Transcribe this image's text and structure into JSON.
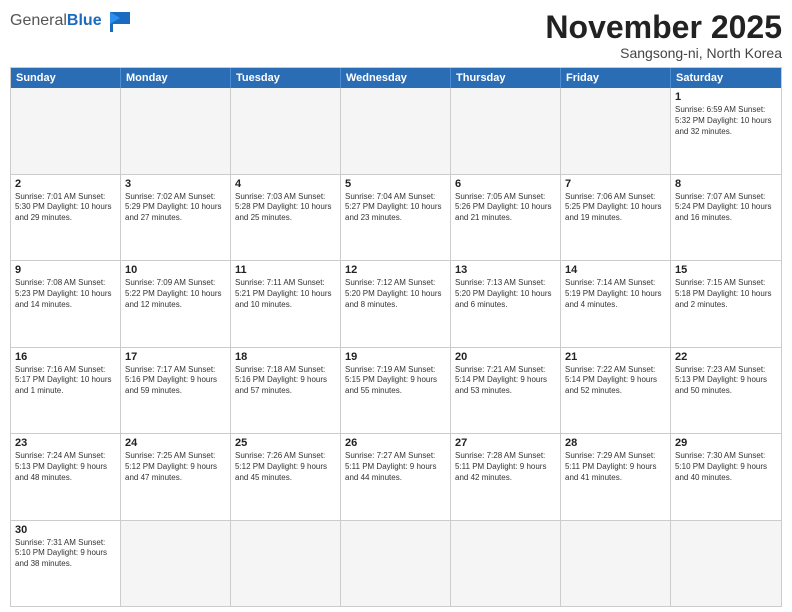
{
  "header": {
    "logo_general": "General",
    "logo_blue": "Blue",
    "month_title": "November 2025",
    "location": "Sangsong-ni, North Korea"
  },
  "days_of_week": [
    "Sunday",
    "Monday",
    "Tuesday",
    "Wednesday",
    "Thursday",
    "Friday",
    "Saturday"
  ],
  "weeks": [
    [
      {
        "day": "",
        "info": "",
        "empty": true
      },
      {
        "day": "",
        "info": "",
        "empty": true
      },
      {
        "day": "",
        "info": "",
        "empty": true
      },
      {
        "day": "",
        "info": "",
        "empty": true
      },
      {
        "day": "",
        "info": "",
        "empty": true
      },
      {
        "day": "",
        "info": "",
        "empty": true
      },
      {
        "day": "1",
        "info": "Sunrise: 6:59 AM\nSunset: 5:32 PM\nDaylight: 10 hours and 32 minutes.",
        "empty": false
      }
    ],
    [
      {
        "day": "2",
        "info": "Sunrise: 7:01 AM\nSunset: 5:30 PM\nDaylight: 10 hours and 29 minutes.",
        "empty": false
      },
      {
        "day": "3",
        "info": "Sunrise: 7:02 AM\nSunset: 5:29 PM\nDaylight: 10 hours and 27 minutes.",
        "empty": false
      },
      {
        "day": "4",
        "info": "Sunrise: 7:03 AM\nSunset: 5:28 PM\nDaylight: 10 hours and 25 minutes.",
        "empty": false
      },
      {
        "day": "5",
        "info": "Sunrise: 7:04 AM\nSunset: 5:27 PM\nDaylight: 10 hours and 23 minutes.",
        "empty": false
      },
      {
        "day": "6",
        "info": "Sunrise: 7:05 AM\nSunset: 5:26 PM\nDaylight: 10 hours and 21 minutes.",
        "empty": false
      },
      {
        "day": "7",
        "info": "Sunrise: 7:06 AM\nSunset: 5:25 PM\nDaylight: 10 hours and 19 minutes.",
        "empty": false
      },
      {
        "day": "8",
        "info": "Sunrise: 7:07 AM\nSunset: 5:24 PM\nDaylight: 10 hours and 16 minutes.",
        "empty": false
      }
    ],
    [
      {
        "day": "9",
        "info": "Sunrise: 7:08 AM\nSunset: 5:23 PM\nDaylight: 10 hours and 14 minutes.",
        "empty": false
      },
      {
        "day": "10",
        "info": "Sunrise: 7:09 AM\nSunset: 5:22 PM\nDaylight: 10 hours and 12 minutes.",
        "empty": false
      },
      {
        "day": "11",
        "info": "Sunrise: 7:11 AM\nSunset: 5:21 PM\nDaylight: 10 hours and 10 minutes.",
        "empty": false
      },
      {
        "day": "12",
        "info": "Sunrise: 7:12 AM\nSunset: 5:20 PM\nDaylight: 10 hours and 8 minutes.",
        "empty": false
      },
      {
        "day": "13",
        "info": "Sunrise: 7:13 AM\nSunset: 5:20 PM\nDaylight: 10 hours and 6 minutes.",
        "empty": false
      },
      {
        "day": "14",
        "info": "Sunrise: 7:14 AM\nSunset: 5:19 PM\nDaylight: 10 hours and 4 minutes.",
        "empty": false
      },
      {
        "day": "15",
        "info": "Sunrise: 7:15 AM\nSunset: 5:18 PM\nDaylight: 10 hours and 2 minutes.",
        "empty": false
      }
    ],
    [
      {
        "day": "16",
        "info": "Sunrise: 7:16 AM\nSunset: 5:17 PM\nDaylight: 10 hours and 1 minute.",
        "empty": false
      },
      {
        "day": "17",
        "info": "Sunrise: 7:17 AM\nSunset: 5:16 PM\nDaylight: 9 hours and 59 minutes.",
        "empty": false
      },
      {
        "day": "18",
        "info": "Sunrise: 7:18 AM\nSunset: 5:16 PM\nDaylight: 9 hours and 57 minutes.",
        "empty": false
      },
      {
        "day": "19",
        "info": "Sunrise: 7:19 AM\nSunset: 5:15 PM\nDaylight: 9 hours and 55 minutes.",
        "empty": false
      },
      {
        "day": "20",
        "info": "Sunrise: 7:21 AM\nSunset: 5:14 PM\nDaylight: 9 hours and 53 minutes.",
        "empty": false
      },
      {
        "day": "21",
        "info": "Sunrise: 7:22 AM\nSunset: 5:14 PM\nDaylight: 9 hours and 52 minutes.",
        "empty": false
      },
      {
        "day": "22",
        "info": "Sunrise: 7:23 AM\nSunset: 5:13 PM\nDaylight: 9 hours and 50 minutes.",
        "empty": false
      }
    ],
    [
      {
        "day": "23",
        "info": "Sunrise: 7:24 AM\nSunset: 5:13 PM\nDaylight: 9 hours and 48 minutes.",
        "empty": false
      },
      {
        "day": "24",
        "info": "Sunrise: 7:25 AM\nSunset: 5:12 PM\nDaylight: 9 hours and 47 minutes.",
        "empty": false
      },
      {
        "day": "25",
        "info": "Sunrise: 7:26 AM\nSunset: 5:12 PM\nDaylight: 9 hours and 45 minutes.",
        "empty": false
      },
      {
        "day": "26",
        "info": "Sunrise: 7:27 AM\nSunset: 5:11 PM\nDaylight: 9 hours and 44 minutes.",
        "empty": false
      },
      {
        "day": "27",
        "info": "Sunrise: 7:28 AM\nSunset: 5:11 PM\nDaylight: 9 hours and 42 minutes.",
        "empty": false
      },
      {
        "day": "28",
        "info": "Sunrise: 7:29 AM\nSunset: 5:11 PM\nDaylight: 9 hours and 41 minutes.",
        "empty": false
      },
      {
        "day": "29",
        "info": "Sunrise: 7:30 AM\nSunset: 5:10 PM\nDaylight: 9 hours and 40 minutes.",
        "empty": false
      }
    ],
    [
      {
        "day": "30",
        "info": "Sunrise: 7:31 AM\nSunset: 5:10 PM\nDaylight: 9 hours and 38 minutes.",
        "empty": false
      },
      {
        "day": "",
        "info": "",
        "empty": true
      },
      {
        "day": "",
        "info": "",
        "empty": true
      },
      {
        "day": "",
        "info": "",
        "empty": true
      },
      {
        "day": "",
        "info": "",
        "empty": true
      },
      {
        "day": "",
        "info": "",
        "empty": true
      },
      {
        "day": "",
        "info": "",
        "empty": true
      }
    ]
  ]
}
